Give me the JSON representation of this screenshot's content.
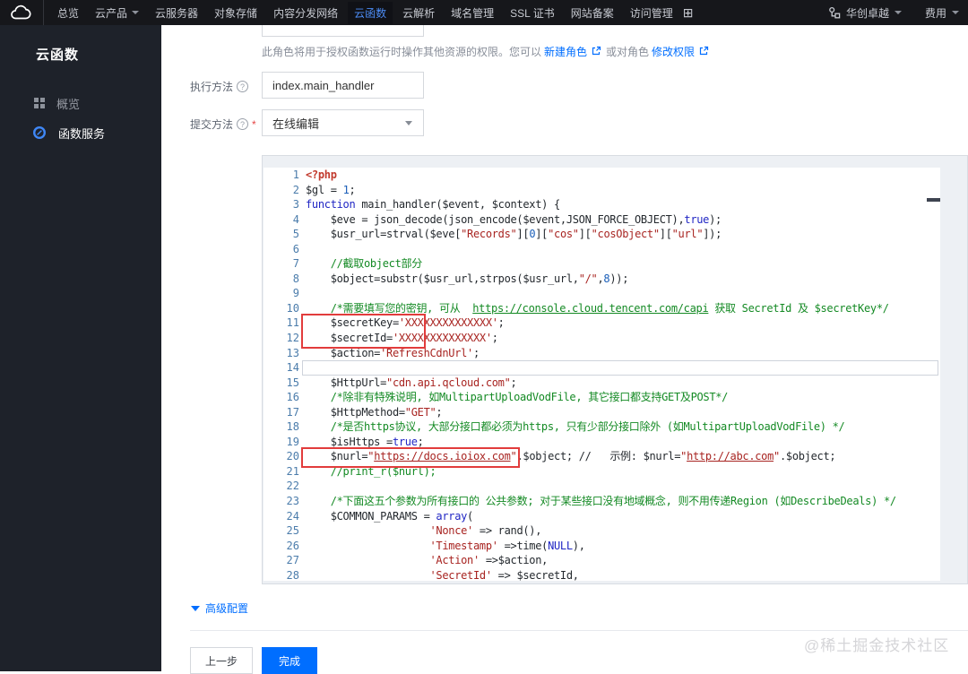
{
  "topbar": {
    "items": [
      {
        "key": "overview",
        "label": "总览"
      },
      {
        "key": "products",
        "label": "云产品",
        "caret": true
      },
      {
        "key": "cvm",
        "label": "云服务器"
      },
      {
        "key": "cos",
        "label": "对象存储"
      },
      {
        "key": "cdn",
        "label": "内容分发网络"
      },
      {
        "key": "scf",
        "label": "云函数",
        "active": true
      },
      {
        "key": "dns",
        "label": "云解析"
      },
      {
        "key": "domains",
        "label": "域名管理"
      },
      {
        "key": "ssl",
        "label": "SSL 证书"
      },
      {
        "key": "beian",
        "label": "网站备案"
      },
      {
        "key": "cam",
        "label": "访问管理"
      }
    ],
    "add_nav_glyph": "⊞",
    "account": "华创卓越",
    "billing": "费用"
  },
  "sidebar": {
    "title": "云函数",
    "items": [
      {
        "key": "overview",
        "label": "概览",
        "icon": "grid-icon",
        "active": false
      },
      {
        "key": "function-service",
        "label": "函数服务",
        "icon": "scf-icon",
        "active": true
      }
    ]
  },
  "form": {
    "role_hint_prefix": "此角色将用于授权函数运行时操作其他资源的权限。您可以",
    "role_hint_link1": "新建角色",
    "role_hint_middle": "或对角色",
    "role_hint_link2": "修改权限",
    "exec_method_label": "执行方法",
    "exec_method_value": "index.main_handler",
    "submit_method_label": "提交方法",
    "submit_required_mark": "*",
    "submit_method_value": "在线编辑",
    "help_glyph": "?"
  },
  "editor": {
    "language": "php",
    "lines": [
      [
        [
          "meta",
          "<?php"
        ]
      ],
      [
        [
          "p",
          "$gl = "
        ],
        [
          "num",
          "1"
        ],
        [
          "p",
          ";"
        ]
      ],
      [
        [
          "kw",
          "function"
        ],
        [
          "p",
          " main_handler($event, $context) {"
        ]
      ],
      [
        [
          "p",
          "    $eve = json_decode(json_encode($event,JSON_FORCE_OBJECT),"
        ],
        [
          "kw",
          "true"
        ],
        [
          "p",
          ");"
        ]
      ],
      [
        [
          "p",
          "    $usr_url=strval($eve["
        ],
        [
          "str",
          "\"Records\""
        ],
        [
          "p",
          "]["
        ],
        [
          "num",
          "0"
        ],
        [
          "p",
          "]["
        ],
        [
          "str",
          "\"cos\""
        ],
        [
          "p",
          "]["
        ],
        [
          "str",
          "\"cosObject\""
        ],
        [
          "p",
          "]["
        ],
        [
          "str",
          "\"url\""
        ],
        [
          "p",
          "]);"
        ]
      ],
      [],
      [
        [
          "com",
          "    //截取object部分"
        ]
      ],
      [
        [
          "p",
          "    $object=substr($usr_url,strpos($usr_url,"
        ],
        [
          "str",
          "\"/\""
        ],
        [
          "p",
          ","
        ],
        [
          "num",
          "8"
        ],
        [
          "p",
          "));"
        ]
      ],
      [],
      [
        [
          "com",
          "    /*需要填写您的密钥, 可从  "
        ],
        [
          "comlink",
          "https://console.cloud.tencent.com/capi"
        ],
        [
          "com",
          " 获取 SecretId 及 $secretKey*/"
        ]
      ],
      [
        [
          "p",
          "    $secretKey="
        ],
        [
          "str",
          "'XXXXXXXXXXXXXX'"
        ],
        [
          "p",
          ";"
        ]
      ],
      [
        [
          "p",
          "    $secretId="
        ],
        [
          "str",
          "'XXXXXXXXXXXXXX'"
        ],
        [
          "p",
          ";"
        ]
      ],
      [
        [
          "p",
          "    $action="
        ],
        [
          "str",
          "'RefreshCdnUrl'"
        ],
        [
          "p",
          ";"
        ]
      ],
      [],
      [
        [
          "p",
          "    $HttpUrl="
        ],
        [
          "str",
          "\"cdn.api.qcloud.com\""
        ],
        [
          "p",
          ";"
        ]
      ],
      [
        [
          "com",
          "    /*除非有特殊说明, 如MultipartUploadVodFile, 其它接口都支持GET及POST*/"
        ]
      ],
      [
        [
          "p",
          "    $HttpMethod="
        ],
        [
          "str",
          "\"GET\""
        ],
        [
          "p",
          ";"
        ]
      ],
      [
        [
          "com",
          "    /*是否https协议, 大部分接口都必须为https, 只有少部分接口除外 (如MultipartUploadVodFile) */"
        ]
      ],
      [
        [
          "p",
          "    $isHttps ="
        ],
        [
          "kw",
          "true"
        ],
        [
          "p",
          ";"
        ]
      ],
      [
        [
          "p",
          "    $nurl="
        ],
        [
          "str",
          "\""
        ],
        [
          "strlink",
          "https://docs.ioiox.com"
        ],
        [
          "str",
          "\""
        ],
        [
          "p",
          ".$object; //   示例: $nurl="
        ],
        [
          "str",
          "\""
        ],
        [
          "strlink",
          "http://abc.com"
        ],
        [
          "str",
          "\""
        ],
        [
          "p",
          ".$object;"
        ]
      ],
      [
        [
          "com",
          "    //print_r($nurl);"
        ]
      ],
      [],
      [
        [
          "com",
          "    /*下面这五个参数为所有接口的 公共参数; 对于某些接口没有地域概念, 则不用传递Region (如DescribeDeals) */"
        ]
      ],
      [
        [
          "p",
          "    $COMMON_PARAMS = "
        ],
        [
          "kw",
          "array"
        ],
        [
          "p",
          "("
        ]
      ],
      [
        [
          "p",
          "                    "
        ],
        [
          "str",
          "'Nonce'"
        ],
        [
          "p",
          " => rand(),"
        ]
      ],
      [
        [
          "p",
          "                    "
        ],
        [
          "str",
          "'Timestamp'"
        ],
        [
          "p",
          " =>time("
        ],
        [
          "kw",
          "NULL"
        ],
        [
          "p",
          "),"
        ]
      ],
      [
        [
          "p",
          "                    "
        ],
        [
          "str",
          "'Action'"
        ],
        [
          "p",
          " =>$action,"
        ]
      ],
      [
        [
          "p",
          "                    "
        ],
        [
          "str",
          "'SecretId'"
        ],
        [
          "p",
          " => $secretId,"
        ]
      ]
    ]
  },
  "footer": {
    "advanced_label": "高级配置",
    "prev_label": "上一步",
    "done_label": "完成"
  },
  "watermark": "@稀土掘金技术社区",
  "colors": {
    "accent": "#006eff",
    "annotation_red": "#e23c3c",
    "topbar_active": "#4c8cf5"
  }
}
